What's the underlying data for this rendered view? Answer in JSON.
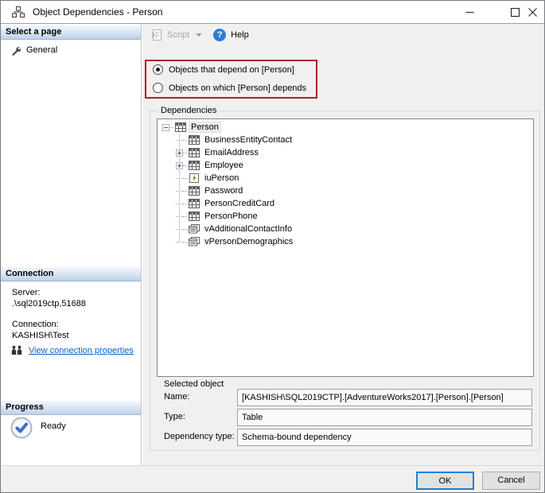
{
  "window": {
    "title": "Object Dependencies - Person"
  },
  "sidebar": {
    "select_page_header": "Select a page",
    "pages": [
      {
        "label": "General",
        "icon": "wrench-icon"
      }
    ],
    "connection_header": "Connection",
    "server_label": "Server:",
    "server_value": ".\\sql2019ctp,51688",
    "connection_label": "Connection:",
    "connection_value": "KASHISH\\Test",
    "view_connection_link": "View connection properties",
    "progress_header": "Progress",
    "progress_status": "Ready"
  },
  "toolbar": {
    "script_label": "Script",
    "script_enabled": false,
    "help_label": "Help",
    "help_icon_glyph": "?"
  },
  "main": {
    "radio_options": [
      {
        "label": "Objects that depend on [Person]",
        "selected": true
      },
      {
        "label": "Objects on which [Person] depends",
        "selected": false
      }
    ],
    "annotation": {
      "shape": "red-rectangle",
      "color": "#b01f26"
    },
    "dependencies_group_label": "Dependencies",
    "tree": {
      "root": {
        "label": "Person",
        "icon": "table-icon",
        "expanded": true,
        "selected": true
      },
      "children": [
        {
          "label": "BusinessEntityContact",
          "icon": "table-icon",
          "expandable": false
        },
        {
          "label": "EmailAddress",
          "icon": "table-icon",
          "expandable": true
        },
        {
          "label": "Employee",
          "icon": "table-icon",
          "expandable": true
        },
        {
          "label": "iuPerson",
          "icon": "trigger-icon",
          "expandable": false
        },
        {
          "label": "Password",
          "icon": "table-icon",
          "expandable": false
        },
        {
          "label": "PersonCreditCard",
          "icon": "table-icon",
          "expandable": false
        },
        {
          "label": "PersonPhone",
          "icon": "table-icon",
          "expandable": false
        },
        {
          "label": "vAdditionalContactInfo",
          "icon": "view-icon",
          "expandable": false
        },
        {
          "label": "vPersonDemographics",
          "icon": "view-icon",
          "expandable": false
        }
      ]
    },
    "selected_object_label": "Selected object",
    "fields": [
      {
        "label": "Name:",
        "value": "[KASHISH\\SQL2019CTP].[AdventureWorks2017].[Person].[Person]"
      },
      {
        "label": "Type:",
        "value": "Table"
      },
      {
        "label": "Dependency type:",
        "value": "Schema-bound dependency"
      }
    ]
  },
  "footer": {
    "ok_label": "OK",
    "cancel_label": "Cancel"
  },
  "colors": {
    "annotation_red": "#b01f26",
    "link_blue": "#0b5fcb",
    "focus_blue": "#1883d7",
    "pane_gray": "#f0f0f0",
    "header_gradient_bottom": "#bdd1e8"
  }
}
